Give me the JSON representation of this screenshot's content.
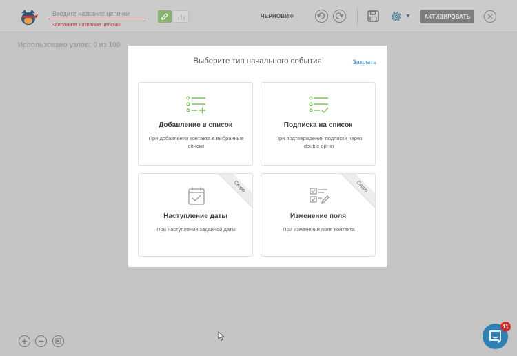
{
  "toolbar": {
    "name_placeholder": "Введите название цепочки",
    "name_value": "",
    "name_error": "Заполните название цепочки",
    "status": "ЧЕРНОВИК",
    "activate_label": "АКТИВИРОВАТЬ"
  },
  "canvas": {
    "usage_text": "Использовано узлов: 0 из 100"
  },
  "modal": {
    "title": "Выберите тип начального события",
    "close_label": "Закрыть",
    "cards": [
      {
        "title": "Добавление в список",
        "description": "При добавлении контакта в выбранные списки",
        "icon": "list-add-icon",
        "badge": ""
      },
      {
        "title": "Подписка на список",
        "description": "При подтверждении подписки через double opt-in",
        "icon": "list-check-icon",
        "badge": ""
      },
      {
        "title": "Наступление даты",
        "description": "При наступлении заданной даты",
        "icon": "calendar-icon",
        "badge": "Скоро"
      },
      {
        "title": "Изменение поля",
        "description": "При изменении поля контакта",
        "icon": "field-edit-icon",
        "badge": "Скоро"
      }
    ]
  },
  "chat": {
    "badge_count": "11"
  },
  "colors": {
    "accent_green": "#7cc25a",
    "link_blue": "#3d8bbd",
    "error_red": "#b93a3a",
    "chat_blue": "#2f7fb3"
  }
}
